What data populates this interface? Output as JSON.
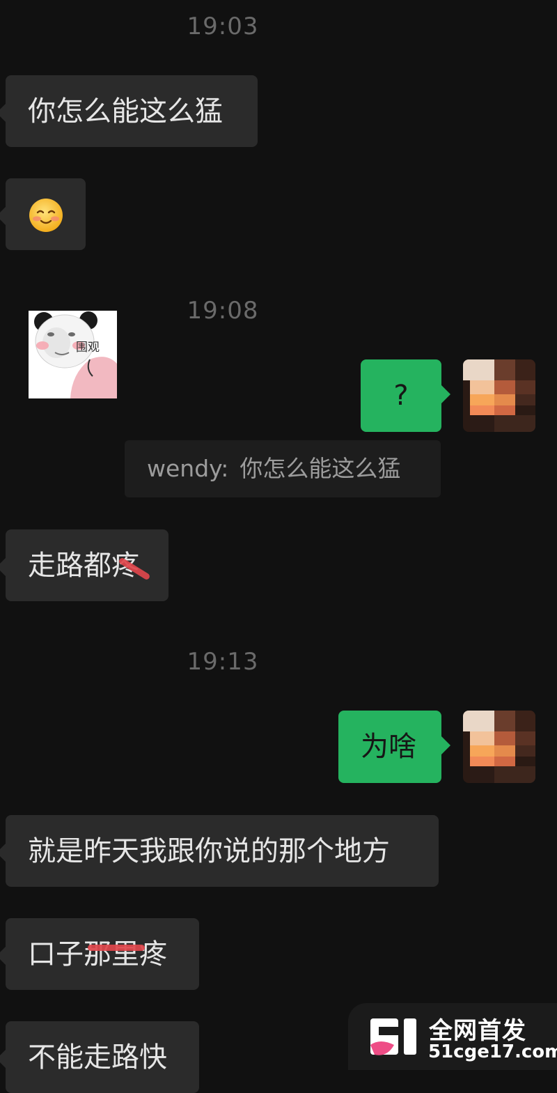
{
  "timestamps": [
    "19:03",
    "19:08",
    "19:13"
  ],
  "messages": {
    "m1": "你怎么能这么猛",
    "m2_emoji": "smiling-face-with-blush",
    "m3_sticker_caption": "围观",
    "m4_out": "?",
    "m4_quote_sender": "wendy",
    "m4_quote_sep": ":",
    "m4_quote_text": "你怎么能这么猛",
    "m5": "走路都疼",
    "m6_out": "为啥",
    "m7": "就是昨天我跟你说的那个地方",
    "m8": "口子那里疼",
    "m9": "不能走路快"
  },
  "watermark": {
    "line1": "全网首发",
    "line2": "51cge17.com"
  },
  "colors": {
    "background": "#111111",
    "incoming_bubble": "#2b2b2b",
    "outgoing_bubble": "#25b35f",
    "strike": "#e0474c"
  }
}
